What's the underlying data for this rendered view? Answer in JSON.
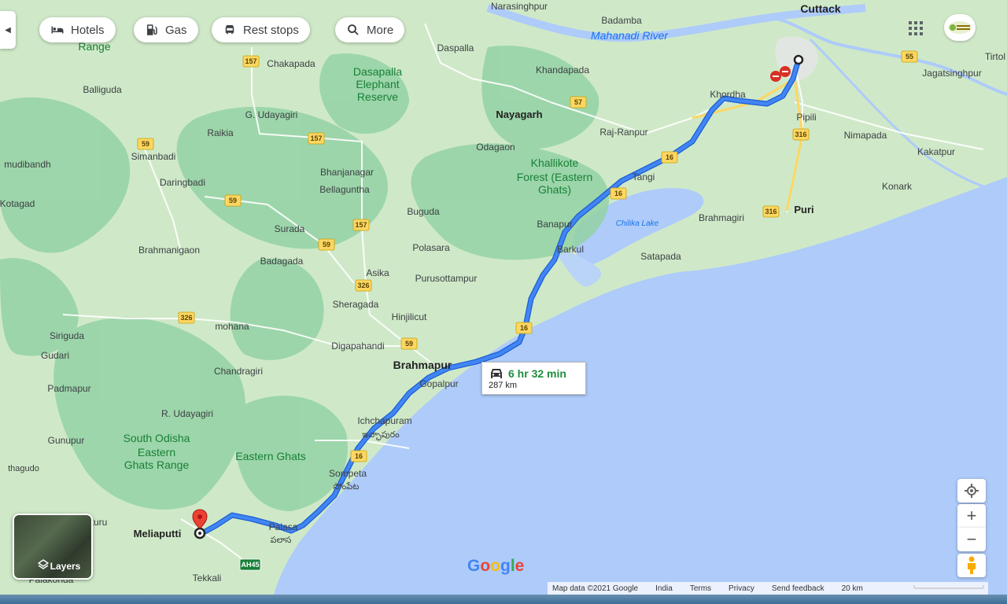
{
  "toolbar": {
    "collapse_glyph": "◀",
    "chips": [
      {
        "label": "Hotels",
        "icon": "bed-icon"
      },
      {
        "label": "Gas",
        "icon": "gas-pump-icon"
      },
      {
        "label": "Rest stops",
        "icon": "rest-stop-icon"
      },
      {
        "label": "More",
        "icon": "search-icon"
      }
    ]
  },
  "route": {
    "duration": "6 hr 32 min",
    "distance": "287 km",
    "mode_icon": "car-icon",
    "color": "#4285f4",
    "origin": "",
    "destination": "Meliaputti"
  },
  "places": [
    "Cuttack",
    "Narasinghpur",
    "Badamba",
    "Mahanadi River",
    "Daspalla",
    "Khandapada",
    "Chakapada",
    "Dasapalla",
    "Elephant",
    "Reserve",
    "Range",
    "Balliguda",
    "G. Udayagiri",
    "Raikia",
    "Nayagarh",
    "Khordha",
    "Raj-Ranpur",
    "Odagaon",
    "Pipili",
    "Jagatsinghpur",
    "Nimapada",
    "Kakatpur",
    "Tirtol",
    "Konark",
    "Puri",
    "Brahmagiri",
    "Simanbadi",
    "mudibandh",
    "Daringbadi",
    "Bhanjanagar",
    "Bellaguntha",
    "Khallikote",
    "Forest (Eastern",
    "Ghats)",
    "Tangi",
    "Kotagad",
    "Buguda",
    "Banapur",
    "Chilika Lake",
    "Surada",
    "Barkul",
    "Satapada",
    "Brahmanigaon",
    "Badagada",
    "Polasara",
    "Asika",
    "Sheragada",
    "Purusottampur",
    "Hinjilicut",
    "mohana",
    "Siriguda",
    "Digapahandi",
    "Gudari",
    "Brahmapur",
    "Gopalpur",
    "Chandragiri",
    "Padmapur",
    "R. Udayagiri",
    "Ichchapuram",
    "ఇచ్ఛాపురం",
    "Gunupur",
    "South Odisha",
    "Eastern",
    "Ghats Range",
    "Eastern Ghats",
    "Sompeta",
    "సోంపేట",
    "thagudo",
    "Palasa",
    "పలాస",
    "turu",
    "Tekkali",
    "Palakonda"
  ],
  "road_shields": [
    "157",
    "157",
    "157",
    "59",
    "59",
    "59",
    "59",
    "326",
    "326",
    "57",
    "16",
    "16",
    "16",
    "16",
    "316",
    "316",
    "55",
    "AH45"
  ],
  "controls": {
    "locate_icon": "my-location-icon",
    "zoom_in": "+",
    "zoom_out": "−",
    "pegman_icon": "pegman-icon"
  },
  "layers_label": "Layers",
  "google_logo": "Google",
  "footer": {
    "map_data": "Map data ©2021 Google",
    "country": "India",
    "terms": "Terms",
    "privacy": "Privacy",
    "feedback": "Send feedback",
    "scale": "20 km"
  },
  "colors": {
    "water": "#aecbfa",
    "land": "#cfe9c8",
    "forest": "#94d2a5",
    "route": "#4285f4",
    "highway": "#fdd663",
    "duration": "#1e8e3e",
    "pin": "#ea4335"
  }
}
